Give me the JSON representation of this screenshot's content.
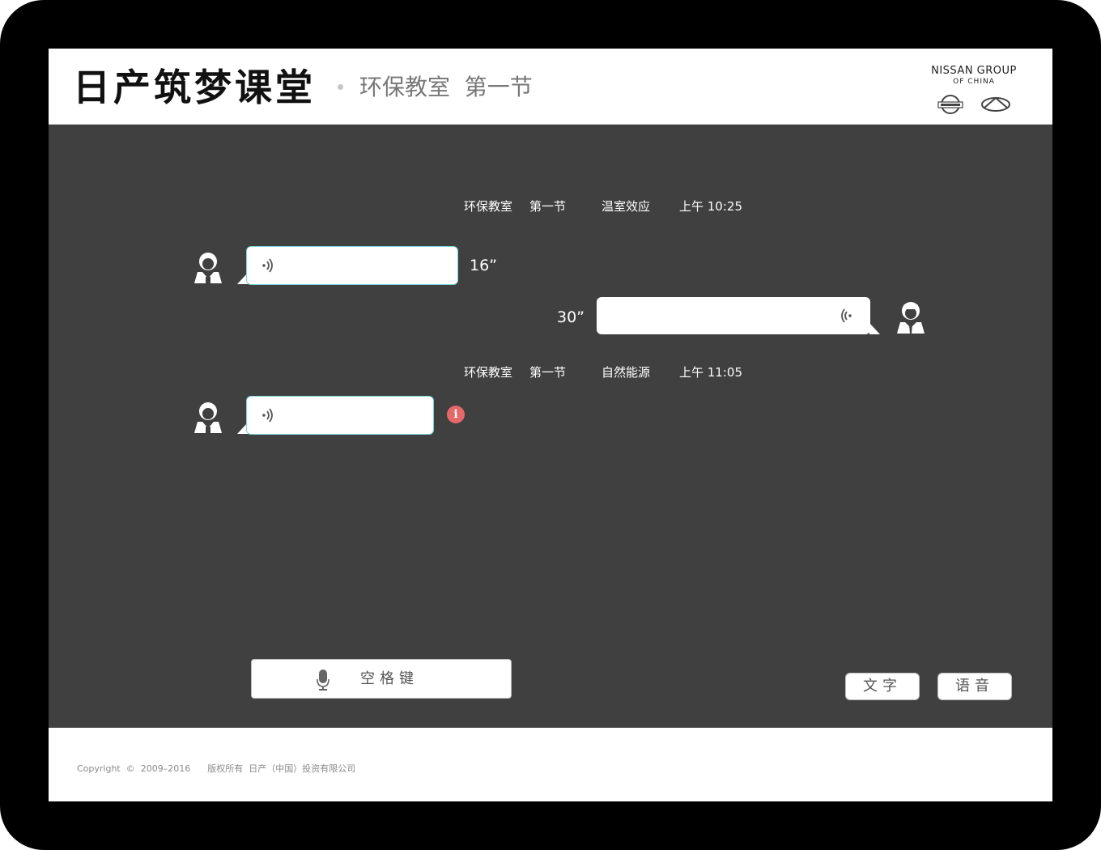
{
  "header": {
    "brand": "日产筑梦课堂",
    "subtitle": "环保教室  第一节",
    "group_line1": "NISSAN GROUP",
    "group_line2": "OF CHINA",
    "logos": [
      "nissan-logo",
      "infiniti-logo"
    ]
  },
  "conversation": {
    "sessions": [
      {
        "course": "环保教室",
        "lesson": "第一节",
        "topic": "温室效应",
        "time": "上午 10:25",
        "messages": [
          {
            "sender": "student",
            "side": "left",
            "duration": "16”",
            "icon": "sound-wave-icon"
          },
          {
            "sender": "teacher",
            "side": "right",
            "duration": "30”",
            "icon": "sound-wave-icon"
          }
        ]
      },
      {
        "course": "环保教室",
        "lesson": "第一节",
        "topic": "自然能源",
        "time": "上午 11:05",
        "messages": [
          {
            "sender": "student",
            "side": "left",
            "status": "failed",
            "status_symbol": "i",
            "icon": "sound-wave-icon"
          }
        ]
      }
    ]
  },
  "input_bar": {
    "spacebar_label": "空格键",
    "mic_icon": "microphone-icon",
    "mode_text": "文字",
    "mode_voice": "语音"
  },
  "footer": {
    "copyright": "Copyright  ©  2009–2016      版权所有  日产（中国）投资有限公司"
  },
  "colors": {
    "background_main": "#404040",
    "bubble_border": "#7fd3dd",
    "alert": "#e5686a"
  }
}
